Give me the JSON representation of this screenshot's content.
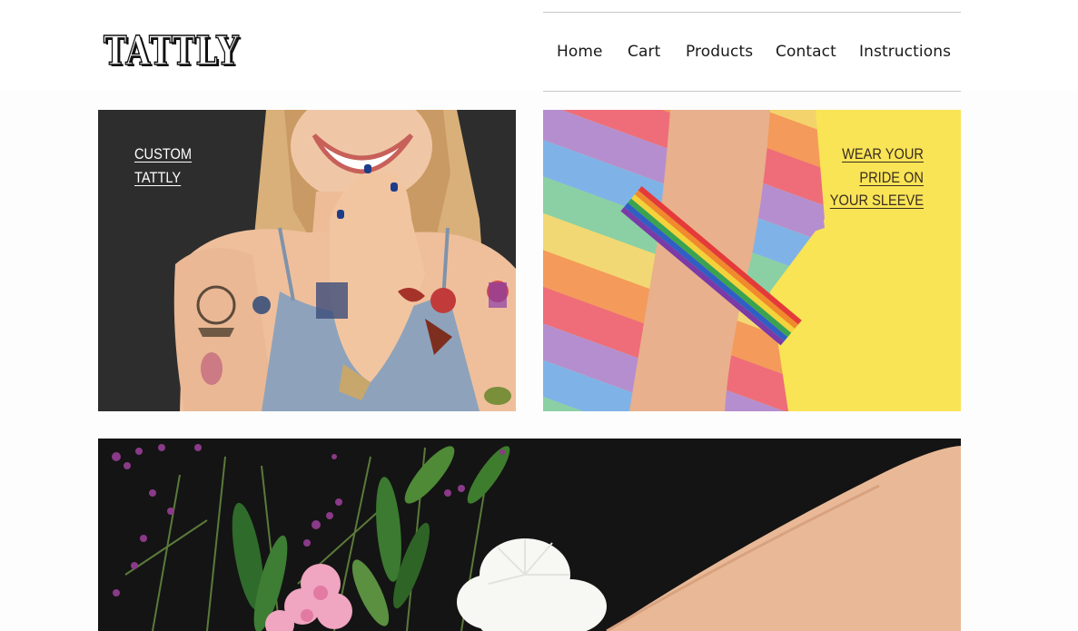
{
  "brand": {
    "logo_text": "TATTLY",
    "logo_mark": "™"
  },
  "nav": {
    "items": [
      {
        "label": "Home"
      },
      {
        "label": "Cart"
      },
      {
        "label": "Products"
      },
      {
        "label": "Contact"
      },
      {
        "label": "Instructions"
      }
    ]
  },
  "tiles": [
    {
      "caption_line1": "CUSTOM",
      "caption_line2": "TATTLY"
    },
    {
      "caption_line1": "WEAR YOUR",
      "caption_line2": "PRIDE ON",
      "caption_line3": "YOUR SLEEVE"
    }
  ],
  "colors": {
    "pride_background": "#f9e456",
    "custom_background": "#2b2b2b",
    "flowers_background": "#121212",
    "nav_text": "#1a1a1a"
  }
}
